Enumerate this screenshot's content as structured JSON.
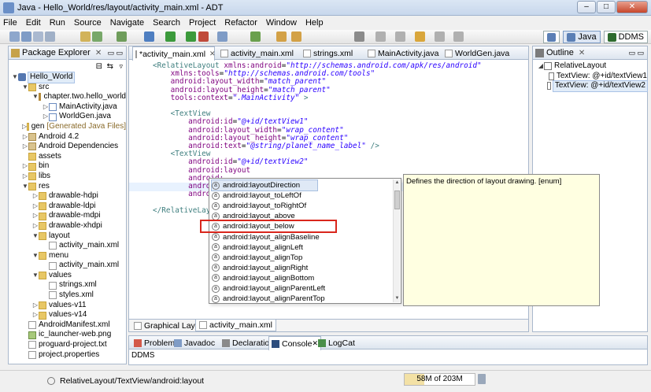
{
  "window": {
    "title": "Java - Hello_World/res/layout/activity_main.xml - ADT",
    "controls": [
      "–",
      "□",
      "✕"
    ]
  },
  "menu": [
    "File",
    "Edit",
    "Run",
    "Source",
    "Navigate",
    "Search",
    "Project",
    "Refactor",
    "Window",
    "Help"
  ],
  "perspectives": {
    "java": "Java",
    "ddms": "DDMS"
  },
  "package_explorer": {
    "tab": "Package Explorer",
    "tree": [
      {
        "label": "Hello_World",
        "depth": 0,
        "icon": "project-icon",
        "twisty": "▼",
        "selected": true
      },
      {
        "label": "src",
        "depth": 1,
        "icon": "folder-icon",
        "twisty": "▼"
      },
      {
        "label": "chapter.two.hello_world",
        "depth": 2,
        "icon": "package-icon",
        "twisty": "▼"
      },
      {
        "label": "MainActivity.java",
        "depth": 3,
        "icon": "java-file-icon",
        "twisty": "▷"
      },
      {
        "label": "WorldGen.java",
        "depth": 3,
        "icon": "java-file-icon",
        "twisty": "▷"
      },
      {
        "label": "gen",
        "note": "[Generated Java Files]",
        "depth": 1,
        "icon": "folder-icon",
        "twisty": "▷"
      },
      {
        "label": "Android 4.2",
        "depth": 1,
        "icon": "library-icon",
        "twisty": "▷"
      },
      {
        "label": "Android Dependencies",
        "depth": 1,
        "icon": "library-icon",
        "twisty": "▷"
      },
      {
        "label": "assets",
        "depth": 1,
        "icon": "folder-icon",
        "twisty": ""
      },
      {
        "label": "bin",
        "depth": 1,
        "icon": "folder-icon",
        "twisty": "▷"
      },
      {
        "label": "libs",
        "depth": 1,
        "icon": "folder-icon",
        "twisty": "▷"
      },
      {
        "label": "res",
        "depth": 1,
        "icon": "folder-icon",
        "twisty": "▼"
      },
      {
        "label": "drawable-hdpi",
        "depth": 2,
        "icon": "folder-icon",
        "twisty": "▷"
      },
      {
        "label": "drawable-ldpi",
        "depth": 2,
        "icon": "folder-icon",
        "twisty": "▷"
      },
      {
        "label": "drawable-mdpi",
        "depth": 2,
        "icon": "folder-icon",
        "twisty": "▷"
      },
      {
        "label": "drawable-xhdpi",
        "depth": 2,
        "icon": "folder-icon",
        "twisty": "▷"
      },
      {
        "label": "layout",
        "depth": 2,
        "icon": "folder-icon",
        "twisty": "▼"
      },
      {
        "label": "activity_main.xml",
        "depth": 3,
        "icon": "xml-file-icon",
        "twisty": ""
      },
      {
        "label": "menu",
        "depth": 2,
        "icon": "folder-icon",
        "twisty": "▼"
      },
      {
        "label": "activity_main.xml",
        "depth": 3,
        "icon": "xml-file-icon",
        "twisty": ""
      },
      {
        "label": "values",
        "depth": 2,
        "icon": "folder-icon",
        "twisty": "▼"
      },
      {
        "label": "strings.xml",
        "depth": 3,
        "icon": "xml-file-icon",
        "twisty": ""
      },
      {
        "label": "styles.xml",
        "depth": 3,
        "icon": "xml-file-icon",
        "twisty": ""
      },
      {
        "label": "values-v11",
        "depth": 2,
        "icon": "folder-icon",
        "twisty": "▷"
      },
      {
        "label": "values-v14",
        "depth": 2,
        "icon": "folder-icon",
        "twisty": "▷"
      },
      {
        "label": "AndroidManifest.xml",
        "depth": 1,
        "icon": "xml-file-icon",
        "twisty": ""
      },
      {
        "label": "ic_launcher-web.png",
        "depth": 1,
        "icon": "image-file-icon",
        "twisty": ""
      },
      {
        "label": "proguard-project.txt",
        "depth": 1,
        "icon": "text-file-icon",
        "twisty": ""
      },
      {
        "label": "project.properties",
        "depth": 1,
        "icon": "text-file-icon",
        "twisty": ""
      }
    ]
  },
  "editor_tabs": [
    {
      "label": "*activity_main.xml",
      "active": true
    },
    {
      "label": "activity_main.xml",
      "active": false
    },
    {
      "label": "strings.xml",
      "active": false
    },
    {
      "label": "MainActivity.java",
      "active": false
    },
    {
      "label": "WorldGen.java",
      "active": false
    }
  ],
  "code_lines": [
    [
      [
        "tag",
        "<RelativeLayout "
      ],
      [
        "attr",
        "xmlns:android"
      ],
      [
        "plain",
        "="
      ],
      [
        "val",
        "\"http://schemas.android.com/apk/res/android\""
      ]
    ],
    [
      [
        "plain",
        "    "
      ],
      [
        "attr",
        "xmlns:tools"
      ],
      [
        "plain",
        "="
      ],
      [
        "val",
        "\"http://schemas.android.com/tools\""
      ]
    ],
    [
      [
        "plain",
        "    "
      ],
      [
        "attr",
        "android:layout_width"
      ],
      [
        "plain",
        "="
      ],
      [
        "val",
        "\"match_parent\""
      ]
    ],
    [
      [
        "plain",
        "    "
      ],
      [
        "attr",
        "android:layout_height"
      ],
      [
        "plain",
        "="
      ],
      [
        "val",
        "\"match_parent\""
      ]
    ],
    [
      [
        "plain",
        "    "
      ],
      [
        "attr",
        "tools:context"
      ],
      [
        "plain",
        "="
      ],
      [
        "val",
        "\".MainActivity\""
      ],
      [
        "tag",
        " >"
      ]
    ],
    [],
    [
      [
        "tag",
        "    <TextView"
      ]
    ],
    [
      [
        "plain",
        "        "
      ],
      [
        "attr",
        "android:id"
      ],
      [
        "plain",
        "="
      ],
      [
        "val",
        "\"@+id/textView1\""
      ]
    ],
    [
      [
        "plain",
        "        "
      ],
      [
        "attr",
        "android:layout_width"
      ],
      [
        "plain",
        "="
      ],
      [
        "val",
        "\"wrap_content\""
      ]
    ],
    [
      [
        "plain",
        "        "
      ],
      [
        "attr",
        "android:layout_height"
      ],
      [
        "plain",
        "="
      ],
      [
        "val",
        "\"wrap_content\""
      ]
    ],
    [
      [
        "plain",
        "        "
      ],
      [
        "attr",
        "android:text"
      ],
      [
        "plain",
        "="
      ],
      [
        "val",
        "\"@string/planet_name_label\""
      ],
      [
        "tag",
        " />"
      ]
    ],
    [
      [
        "tag",
        "    <TextView"
      ]
    ],
    [
      [
        "plain",
        "        "
      ],
      [
        "attr",
        "android:id"
      ],
      [
        "plain",
        "="
      ],
      [
        "val",
        "\"@+id/textView2\""
      ]
    ],
    [
      [
        "plain",
        "        "
      ],
      [
        "attr",
        "android:layout"
      ]
    ],
    [
      [
        "plain",
        "        "
      ],
      [
        "attr",
        "android:"
      ]
    ],
    [
      [
        "plain",
        "        "
      ],
      [
        "attr",
        "android:"
      ]
    ],
    [
      [
        "plain",
        "        "
      ],
      [
        "attr",
        "android:"
      ]
    ],
    [],
    [
      [
        "tag",
        "</RelativeLayout"
      ]
    ]
  ],
  "editor_bottom_tabs": [
    {
      "label": "Graphical Layout",
      "active": false
    },
    {
      "label": "activity_main.xml",
      "active": true
    }
  ],
  "content_assist": {
    "proposals": [
      "android:layoutDirection",
      "android:layout_toLeftOf",
      "android:layout_toRightOf",
      "android:layout_above",
      "android:layout_below",
      "android:layout_alignBaseline",
      "android:layout_alignLeft",
      "android:layout_alignTop",
      "android:layout_alignRight",
      "android:layout_alignBottom",
      "android:layout_alignParentLeft",
      "android:layout_alignParentTop"
    ],
    "selected_index": 0,
    "highlighted_index": 4,
    "doc": "Defines the direction of layout drawing. [enum]"
  },
  "outline": {
    "tab": "Outline",
    "tree": [
      {
        "label": "RelativeLayout",
        "depth": 0,
        "twisty": "◢"
      },
      {
        "label": "TextView: @+id/textView1",
        "depth": 1,
        "twisty": ""
      },
      {
        "label": "TextView: @+id/textView2",
        "depth": 1,
        "twisty": "",
        "selected": true
      }
    ]
  },
  "console": {
    "tabs": [
      {
        "label": "Problems",
        "active": false
      },
      {
        "label": "Javadoc",
        "active": false
      },
      {
        "label": "Declaration",
        "active": false
      },
      {
        "label": "Console",
        "active": true
      },
      {
        "label": "LogCat",
        "active": false
      }
    ],
    "text": "DDMS"
  },
  "status": {
    "path": "RelativeLayout/TextView/android:layout",
    "heap": "58M of 203M",
    "heap_used_fraction": 0.286
  },
  "colors": {
    "xml_tag": "#3f7f7f",
    "xml_attr": "#7f007f",
    "xml_value": "#2a00ff",
    "highlight_box": "#d9261c",
    "doc_bg": "#ffffe1"
  }
}
